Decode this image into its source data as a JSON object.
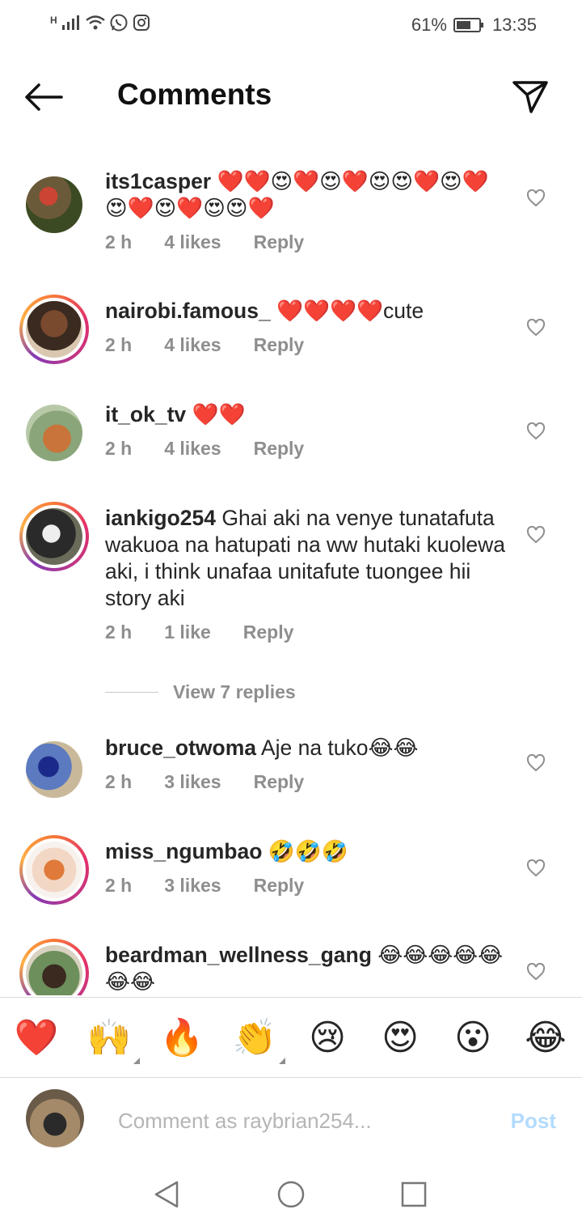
{
  "status_bar": {
    "signal_label": "H",
    "battery_percent": "61%",
    "time": "13:35",
    "icons": [
      "signal-icon",
      "wifi-icon",
      "whatsapp-icon",
      "instagram-icon",
      "battery-icon"
    ]
  },
  "header": {
    "title": "Comments",
    "back_icon": "back-arrow-icon",
    "share_icon": "send-icon"
  },
  "comments": [
    {
      "username": "its1casper",
      "text": "❤️❤️😍❤️😍❤️😍😍❤️😍❤️😍❤️😍❤️😍😍❤️",
      "time": "2 h",
      "likes": "4 likes",
      "reply": "Reply",
      "story_ring": false
    },
    {
      "username": "nairobi.famous_",
      "text": "❤️❤️❤️❤️cute",
      "time": "2 h",
      "likes": "4 likes",
      "reply": "Reply",
      "story_ring": true
    },
    {
      "username": "it_ok_tv",
      "text": "❤️❤️",
      "time": "2 h",
      "likes": "4 likes",
      "reply": "Reply",
      "story_ring": false
    },
    {
      "username": "iankigo254",
      "text": "Ghai aki na venye tunatafuta wakuoa na hatupati na ww hutaki kuolewa aki, i think unafaa unitafute tuongee hii story aki",
      "time": "2 h",
      "likes": "1 like",
      "reply": "Reply",
      "story_ring": true
    },
    {
      "username": "bruce_otwoma",
      "text": "Aje na tuko😂😂",
      "time": "2 h",
      "likes": "3 likes",
      "reply": "Reply",
      "story_ring": false
    },
    {
      "username": "miss_ngumbao",
      "text": "🤣🤣🤣",
      "time": "2 h",
      "likes": "3 likes",
      "reply": "Reply",
      "story_ring": true
    },
    {
      "username": "beardman_wellness_gang",
      "text": "😂😂😂😂😂😂😂",
      "time": "",
      "likes": "",
      "reply": "",
      "story_ring": true
    }
  ],
  "view_replies": "View 7 replies",
  "reactions": [
    "❤️",
    "🙌",
    "🔥",
    "👏",
    "😢",
    "😍",
    "😮",
    "😂"
  ],
  "composer": {
    "placeholder": "Comment as raybrian254...",
    "post_label": "Post"
  },
  "nav": {
    "back": "nav-back-icon",
    "home": "nav-home-icon",
    "recents": "nav-recents-icon"
  },
  "colors": {
    "text": "#262626",
    "meta": "#8e8e8e",
    "post_disabled": "#b3dbff",
    "heart": "#e0151b"
  }
}
